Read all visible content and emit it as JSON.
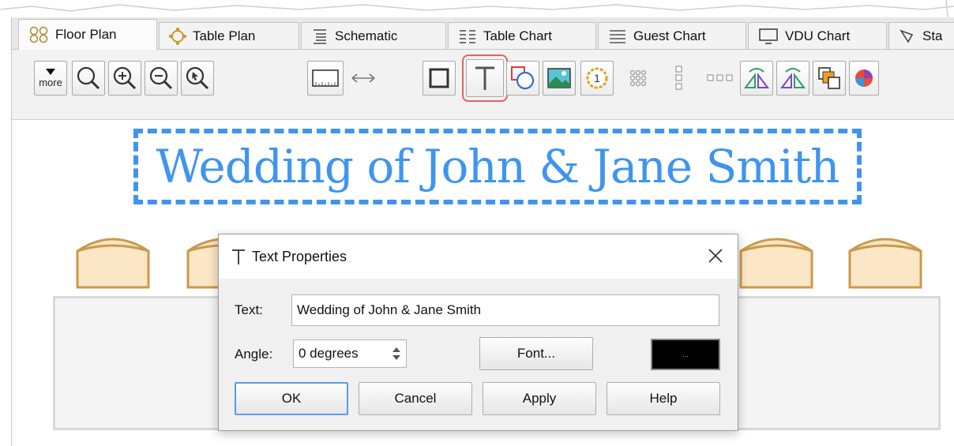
{
  "tabs": [
    {
      "label": "Floor Plan",
      "icon": "floor-plan-icon",
      "active": true
    },
    {
      "label": "Table Plan",
      "icon": "table-plan-icon"
    },
    {
      "label": "Schematic",
      "icon": "schematic-icon"
    },
    {
      "label": "Table Chart",
      "icon": "table-chart-icon"
    },
    {
      "label": "Guest Chart",
      "icon": "guest-chart-icon"
    },
    {
      "label": "VDU Chart",
      "icon": "vdu-chart-icon"
    },
    {
      "label": "Sta",
      "icon": "stationery-icon"
    }
  ],
  "toolbar": {
    "more_label": "more",
    "buttons": [
      "zoom-icon",
      "zoom-in-icon",
      "zoom-out-icon",
      "zoom-select-icon",
      "ruler-icon",
      "dimension-icon",
      "rectangle-icon",
      "text-icon",
      "shapes-icon",
      "image-icon",
      "number-icon",
      "grid-icon",
      "column-icon",
      "row-icon",
      "flip-horizontal-icon",
      "flip-vertical-icon",
      "arrange-icon",
      "color-icon"
    ],
    "highlighted": "text-icon"
  },
  "canvas": {
    "title_text": "Wedding of John & Jane Smith",
    "title_color": "#3f95ee"
  },
  "dialog": {
    "title": "Text Properties",
    "text_label": "Text:",
    "text_value": "Wedding of John & Jane Smith",
    "angle_label": "Angle:",
    "angle_value": "0 degrees",
    "font_button": "Font...",
    "color_button_label": "...",
    "color_value": "#000000",
    "ok": "OK",
    "cancel": "Cancel",
    "apply": "Apply",
    "help": "Help"
  }
}
